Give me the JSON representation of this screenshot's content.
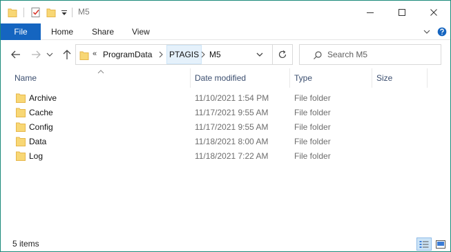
{
  "window": {
    "title": "M5"
  },
  "ribbon": {
    "tabs": [
      {
        "label": "File",
        "active": true
      },
      {
        "label": "Home"
      },
      {
        "label": "Share"
      },
      {
        "label": "View"
      }
    ]
  },
  "address": {
    "overflow": "«",
    "crumbs": [
      "ProgramData",
      "PTAGIS",
      "M5"
    ],
    "highlighted_crumb": "PTAGIS"
  },
  "search": {
    "placeholder": "Search M5"
  },
  "columns": {
    "name": "Name",
    "date": "Date modified",
    "type": "Type",
    "size": "Size"
  },
  "files": [
    {
      "name": "Archive",
      "date": "11/10/2021 1:54 PM",
      "type": "File folder",
      "size": ""
    },
    {
      "name": "Cache",
      "date": "11/17/2021 9:55 AM",
      "type": "File folder",
      "size": ""
    },
    {
      "name": "Config",
      "date": "11/17/2021 9:55 AM",
      "type": "File folder",
      "size": ""
    },
    {
      "name": "Data",
      "date": "11/18/2021 8:00 AM",
      "type": "File folder",
      "size": ""
    },
    {
      "name": "Log",
      "date": "11/18/2021 7:22 AM",
      "type": "File folder",
      "size": ""
    }
  ],
  "status": {
    "item_count": "5 items"
  },
  "colors": {
    "accent": "#1565c0",
    "window_border": "#1a8a7a",
    "folder": "#f8d775",
    "folder_dark": "#e6b64a"
  },
  "icons": {
    "folder": "folder-icon",
    "properties": "properties-icon",
    "back": "back-arrow-icon",
    "forward": "forward-arrow-icon",
    "up": "up-arrow-icon",
    "refresh": "refresh-icon",
    "search": "search-icon"
  }
}
